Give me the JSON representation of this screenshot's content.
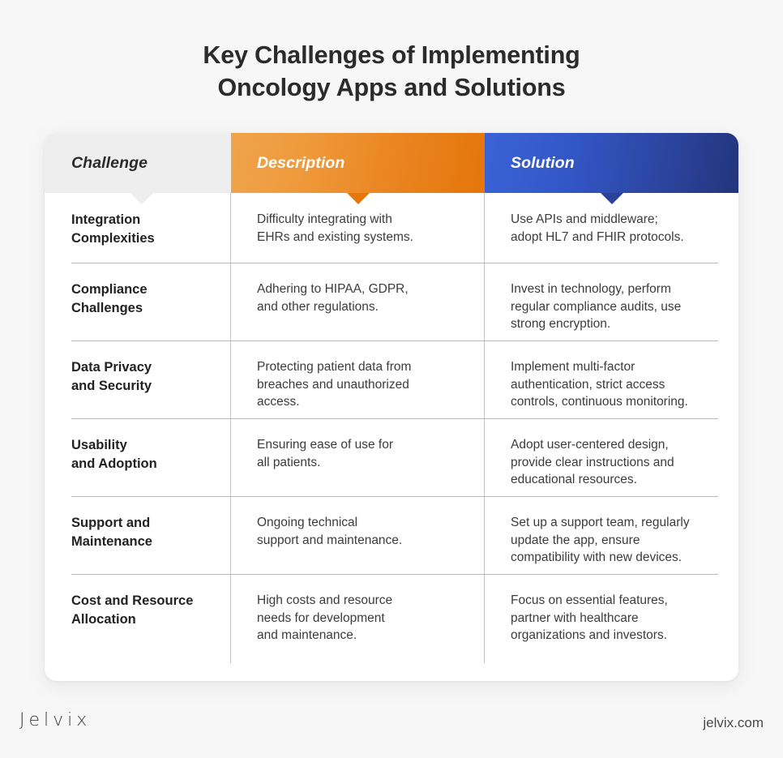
{
  "title": {
    "line1": "Key Challenges of Implementing",
    "line2": "Oncology Apps and Solutions"
  },
  "table": {
    "headers": {
      "challenge": "Challenge",
      "description": "Description",
      "solution": "Solution"
    },
    "header_colors": {
      "challenge_bg": "#eeeeee",
      "description_bg_start": "#efa44c",
      "description_bg_end": "#e4760a",
      "solution_bg_start": "#3a63d6",
      "solution_bg_end": "#23347b"
    },
    "rows": [
      {
        "challenge": "Integration\nComplexities",
        "description": "Difficulty integrating with\nEHRs and existing systems.",
        "solution": "Use APIs and middleware;\nadopt HL7 and FHIR protocols."
      },
      {
        "challenge": "Compliance\nChallenges",
        "description": "Adhering to HIPAA, GDPR,\nand other regulations.",
        "solution": "Invest in technology, perform\nregular compliance audits, use\nstrong encryption."
      },
      {
        "challenge": "Data Privacy\nand Security",
        "description": "Protecting patient data from\nbreaches and unauthorized\naccess.",
        "solution": "Implement multi-factor\nauthentication, strict access\ncontrols, continuous monitoring."
      },
      {
        "challenge": "Usability\nand Adoption",
        "description": "Ensuring ease of use for\nall patients.",
        "solution": "Adopt user-centered design,\nprovide clear instructions and\neducational resources."
      },
      {
        "challenge": "Support and\nMaintenance",
        "description": "Ongoing technical\nsupport and maintenance.",
        "solution": "Set up a support team, regularly\nupdate the app, ensure\ncompatibility with new devices."
      },
      {
        "challenge": "Cost and Resource\nAllocation",
        "description": "High costs and resource\nneeds for development\nand maintenance.",
        "solution": "Focus on essential features,\npartner with healthcare\norganizations and investors."
      }
    ]
  },
  "footer": {
    "logo": "Jelvix",
    "website": "jelvix.com"
  }
}
